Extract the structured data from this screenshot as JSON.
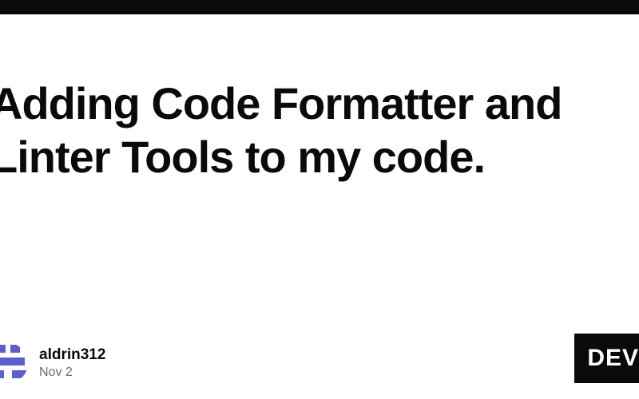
{
  "post": {
    "title": "Adding Code Formatter and Linter Tools to my code."
  },
  "author": {
    "username": "aldrin312",
    "date": "Nov 2"
  },
  "badge": {
    "label": "DEV"
  }
}
